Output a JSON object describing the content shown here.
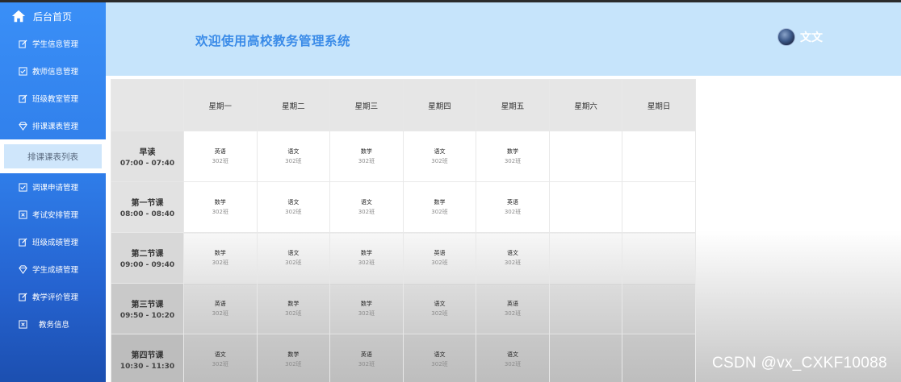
{
  "sidebar": {
    "home_label": "后台首页",
    "items": [
      {
        "label": "学生信息管理",
        "icon": "edit-icon"
      },
      {
        "label": "教师信息管理",
        "icon": "checkbox-icon"
      },
      {
        "label": "班级教室管理",
        "icon": "edit-icon"
      },
      {
        "label": "排课课表管理",
        "icon": "diamond-icon"
      },
      {
        "label": "调课申请管理",
        "icon": "checkbox-icon"
      },
      {
        "label": "考试安排管理",
        "icon": "close-square-icon"
      },
      {
        "label": "班级成绩管理",
        "icon": "edit-icon"
      },
      {
        "label": "学生成绩管理",
        "icon": "diamond-icon"
      },
      {
        "label": "教学评价管理",
        "icon": "edit-icon"
      },
      {
        "label": "教务信息",
        "icon": "close-square-icon"
      }
    ],
    "active_submenu": "排课课表列表"
  },
  "header": {
    "title": "欢迎使用高校教务管理系统",
    "username": "文文"
  },
  "timetable": {
    "days": [
      "星期一",
      "星期二",
      "星期三",
      "星期四",
      "星期五",
      "星期六",
      "星期日"
    ],
    "periods": [
      {
        "name": "早读",
        "time": "07:00 - 07:40",
        "cells": [
          {
            "s": "英语",
            "c": "302班"
          },
          {
            "s": "语文",
            "c": "302班"
          },
          {
            "s": "数学",
            "c": "302班"
          },
          {
            "s": "语文",
            "c": "302班"
          },
          {
            "s": "数学",
            "c": "302班"
          },
          {
            "s": "",
            "c": ""
          },
          {
            "s": "",
            "c": ""
          }
        ]
      },
      {
        "name": "第一节课",
        "time": "08:00 - 08:40",
        "cells": [
          {
            "s": "数学",
            "c": "302班"
          },
          {
            "s": "语文",
            "c": "302班"
          },
          {
            "s": "语文",
            "c": "302班"
          },
          {
            "s": "数学",
            "c": "302班"
          },
          {
            "s": "英语",
            "c": "302班"
          },
          {
            "s": "",
            "c": ""
          },
          {
            "s": "",
            "c": ""
          }
        ]
      },
      {
        "name": "第二节课",
        "time": "09:00 - 09:40",
        "cells": [
          {
            "s": "数学",
            "c": "302班"
          },
          {
            "s": "语文",
            "c": "302班"
          },
          {
            "s": "数学",
            "c": "302班"
          },
          {
            "s": "英语",
            "c": "302班"
          },
          {
            "s": "语文",
            "c": "302班"
          },
          {
            "s": "",
            "c": ""
          },
          {
            "s": "",
            "c": ""
          }
        ]
      },
      {
        "name": "第三节课",
        "time": "09:50 - 10:20",
        "cells": [
          {
            "s": "英语",
            "c": "302班"
          },
          {
            "s": "数学",
            "c": "302班"
          },
          {
            "s": "数学",
            "c": "302班"
          },
          {
            "s": "语文",
            "c": "302班"
          },
          {
            "s": "英语",
            "c": "302班"
          },
          {
            "s": "",
            "c": ""
          },
          {
            "s": "",
            "c": ""
          }
        ]
      },
      {
        "name": "第四节课",
        "time": "10:30 - 11:30",
        "cells": [
          {
            "s": "语文",
            "c": "302班"
          },
          {
            "s": "数学",
            "c": "302班"
          },
          {
            "s": "英语",
            "c": "302班"
          },
          {
            "s": "语文",
            "c": "302班"
          },
          {
            "s": "语文",
            "c": "302班"
          },
          {
            "s": "",
            "c": ""
          },
          {
            "s": "",
            "c": ""
          }
        ]
      }
    ]
  },
  "watermark": "CSDN @vx_CXKF10088",
  "colors": {
    "sidebar": "#2f7de9",
    "header": "#c6e4fb",
    "title": "#3a8be8",
    "submenu_active": "#cfe6fb"
  }
}
